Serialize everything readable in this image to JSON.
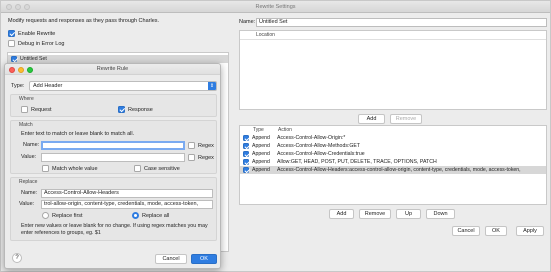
{
  "window": {
    "title": "Rewrite Settings"
  },
  "left": {
    "description": "Modify requests and responses as they pass through Charles.",
    "enable_rewrite": "Enable Rewrite",
    "debug": "Debug in Error Log",
    "sets": [
      {
        "name": "Untitled Set"
      }
    ]
  },
  "right": {
    "name_label": "Name:",
    "name_value": "Untitled Set",
    "location_header": "Location",
    "add_label": "Add",
    "remove_label": "Remove",
    "rules_headers": {
      "type": "Type",
      "action": "Action"
    },
    "rules": [
      {
        "type": "Append",
        "action": "Access-Control-Allow-Origin:*"
      },
      {
        "type": "Append",
        "action": "Access-Control-Allow-Methods:GET"
      },
      {
        "type": "Append",
        "action": "Access-Control-Allow-Credentials:true"
      },
      {
        "type": "Append",
        "action": "Allow:GET, HEAD, POST, PUT, DELETE, TRACE, OPTIONS, PATCH"
      },
      {
        "type": "Append",
        "action": "Access-Control-Allow-Headers:access-control-allow-origin, content-type, credentials, mode, access-token,"
      }
    ],
    "buttons": {
      "add": "Add",
      "remove": "Remove",
      "up": "Up",
      "down": "Down"
    },
    "footer": {
      "cancel": "Cancel",
      "ok": "OK",
      "apply": "Apply"
    }
  },
  "dialog": {
    "title": "Rewrite Rule",
    "type_label": "Type:",
    "type_value": "Add Header",
    "where_label": "Where",
    "request": "Request",
    "response": "Response",
    "match_label": "Match",
    "match_hint": "Enter text to match or leave blank to match all.",
    "name_label": "Name:",
    "value_label": "Value:",
    "regex": "Regex",
    "match_whole": "Match whole value",
    "case_sensitive": "Case sensitive",
    "replace_label": "Replace",
    "rep_name_value": "Access-Control-Allow-Headers",
    "rep_value_value": "trol-allow-origin, content-type, credentials, mode, access-token,",
    "replace_first": "Replace first",
    "replace_all": "Replace all",
    "hint": "Enter new values or leave blank for no change. If using regex matches you may enter references to groups, eg. $1",
    "help": "?",
    "cancel": "Cancel",
    "ok": "OK"
  }
}
